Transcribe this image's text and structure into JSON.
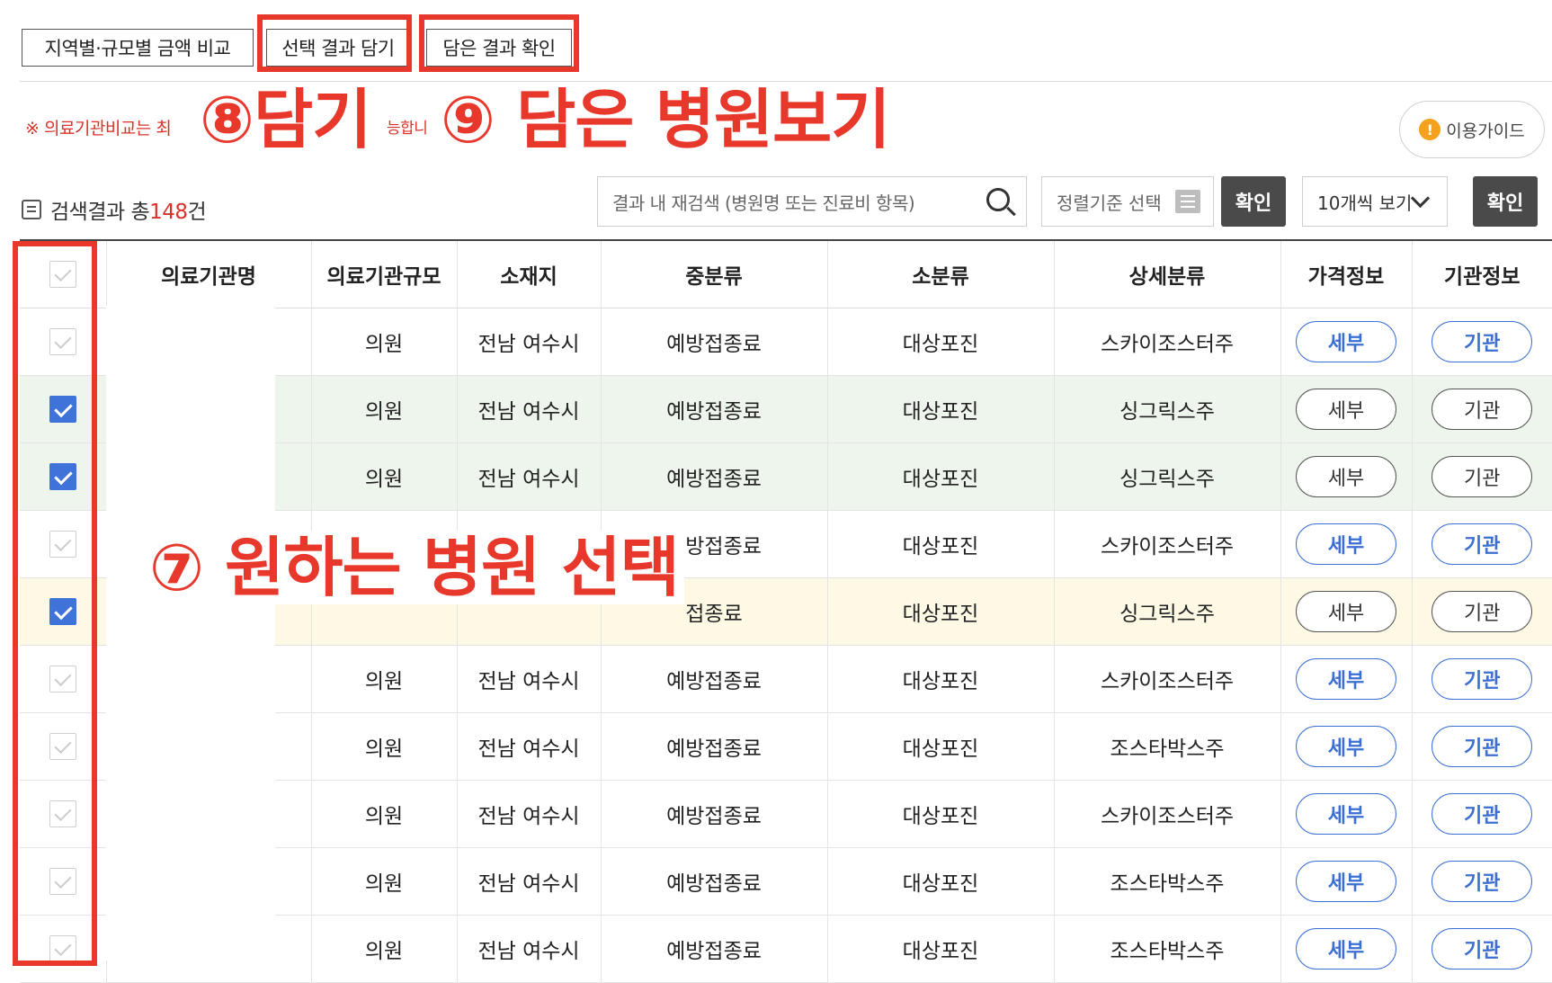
{
  "toolbar": {
    "compare_label": "지역별·규모별 금액 비교",
    "add_label": "선택 결과 담기",
    "view_label": "담은 결과 확인"
  },
  "notice": {
    "text_left": "※ 의료기관비교는 최",
    "text_mid": "능합니"
  },
  "annotations": {
    "step8": "⑧담기",
    "step9": "⑨ 담은 병원보기",
    "step7": "⑦ 원하는 병원 선택"
  },
  "guide": {
    "icon": "!",
    "label": "이용가이드"
  },
  "results": {
    "prefix": "검색결과 총",
    "count": "148",
    "suffix": "건"
  },
  "search": {
    "placeholder": "결과 내 재검색 (병원명 또는 진료비 항목)"
  },
  "sort": {
    "label": "정렬기준 선택"
  },
  "confirm_label": "확인",
  "page_size": {
    "label": "10개씩 보기"
  },
  "table": {
    "headers": [
      "의료기관명",
      "의료기관규모",
      "소재지",
      "중분류",
      "소분류",
      "상세분류",
      "가격정보",
      "기관정보"
    ],
    "rows": [
      {
        "size": "의원",
        "loc": "전남 여수시",
        "mid": "예방접종료",
        "small": "대상포진",
        "detail": "스카이조스터주",
        "price": "세부",
        "org": "기관"
      },
      {
        "size": "의원",
        "loc": "전남 여수시",
        "mid": "예방접종료",
        "small": "대상포진",
        "detail": "싱그릭스주",
        "price": "세부",
        "org": "기관"
      },
      {
        "size": "의원",
        "loc": "전남 여수시",
        "mid": "예방접종료",
        "small": "대상포진",
        "detail": "싱그릭스주",
        "price": "세부",
        "org": "기관"
      },
      {
        "size": "",
        "loc": "",
        "mid": "예방접종료",
        "small": "대상포진",
        "detail": "스카이조스터주",
        "price": "세부",
        "org": "기관"
      },
      {
        "size": "",
        "loc": "",
        "mid": "접종료",
        "small": "대상포진",
        "detail": "싱그릭스주",
        "price": "세부",
        "org": "기관"
      },
      {
        "size": "의원",
        "loc": "전남 여수시",
        "mid": "예방접종료",
        "small": "대상포진",
        "detail": "스카이조스터주",
        "price": "세부",
        "org": "기관"
      },
      {
        "size": "의원",
        "loc": "전남 여수시",
        "mid": "예방접종료",
        "small": "대상포진",
        "detail": "조스타박스주",
        "price": "세부",
        "org": "기관"
      },
      {
        "size": "의원",
        "loc": "전남 여수시",
        "mid": "예방접종료",
        "small": "대상포진",
        "detail": "스카이조스터주",
        "price": "세부",
        "org": "기관"
      },
      {
        "size": "의원",
        "loc": "전남 여수시",
        "mid": "예방접종료",
        "small": "대상포진",
        "detail": "조스타박스주",
        "price": "세부",
        "org": "기관"
      },
      {
        "size": "의원",
        "loc": "전남 여수시",
        "mid": "예방접종료",
        "small": "대상포진",
        "detail": "조스타박스주",
        "price": "세부",
        "org": "기관"
      }
    ]
  },
  "colors": {
    "annotation_red": "#e8382b",
    "accent_blue": "#3c6fd2",
    "checked_blue": "#3f73d9",
    "count_red": "#d9322b"
  }
}
